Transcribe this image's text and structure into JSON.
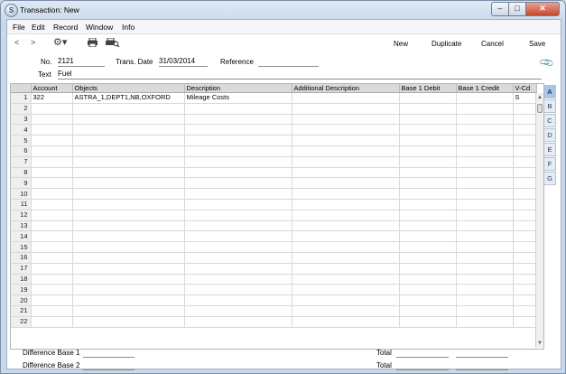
{
  "window": {
    "title": "Transaction: New",
    "app_icon_glyph": "S"
  },
  "menu": [
    "File",
    "Edit",
    "Record",
    "Window",
    "Info"
  ],
  "toolbar": {
    "nav_prev": "<",
    "nav_next": ">",
    "new_label": "New",
    "duplicate_label": "Duplicate",
    "cancel_label": "Cancel",
    "save_label": "Save",
    "icons": [
      "gear-icon",
      "print-icon",
      "print-preview-icon"
    ]
  },
  "form": {
    "no_label": "No.",
    "no_value": "2121",
    "trans_date_label": "Trans. Date",
    "trans_date_value": "31/03/2014",
    "reference_label": "Reference",
    "reference_value": "",
    "text_label": "Text",
    "text_value": "Fuel"
  },
  "grid": {
    "columns": [
      "",
      "Account",
      "Objects",
      "Description",
      "Additional Description",
      "Base 1 Debit",
      "Base 1 Credit",
      "V-Cd"
    ],
    "rows": [
      [
        "1",
        "322",
        "ASTRA_1,DEPT1,NB,OXFORD",
        "Mileage Costs",
        "",
        "",
        "",
        "S"
      ],
      [
        "2",
        "",
        "",
        "",
        "",
        "",
        "",
        ""
      ],
      [
        "3",
        "",
        "",
        "",
        "",
        "",
        "",
        ""
      ],
      [
        "4",
        "",
        "",
        "",
        "",
        "",
        "",
        ""
      ],
      [
        "5",
        "",
        "",
        "",
        "",
        "",
        "",
        ""
      ],
      [
        "6",
        "",
        "",
        "",
        "",
        "",
        "",
        ""
      ],
      [
        "7",
        "",
        "",
        "",
        "",
        "",
        "",
        ""
      ],
      [
        "8",
        "",
        "",
        "",
        "",
        "",
        "",
        ""
      ],
      [
        "9",
        "",
        "",
        "",
        "",
        "",
        "",
        ""
      ],
      [
        "10",
        "",
        "",
        "",
        "",
        "",
        "",
        ""
      ],
      [
        "11",
        "",
        "",
        "",
        "",
        "",
        "",
        ""
      ],
      [
        "12",
        "",
        "",
        "",
        "",
        "",
        "",
        ""
      ],
      [
        "13",
        "",
        "",
        "",
        "",
        "",
        "",
        ""
      ],
      [
        "14",
        "",
        "",
        "",
        "",
        "",
        "",
        ""
      ],
      [
        "15",
        "",
        "",
        "",
        "",
        "",
        "",
        ""
      ],
      [
        "16",
        "",
        "",
        "",
        "",
        "",
        "",
        ""
      ],
      [
        "17",
        "",
        "",
        "",
        "",
        "",
        "",
        ""
      ],
      [
        "18",
        "",
        "",
        "",
        "",
        "",
        "",
        ""
      ],
      [
        "19",
        "",
        "",
        "",
        "",
        "",
        "",
        ""
      ],
      [
        "20",
        "",
        "",
        "",
        "",
        "",
        "",
        ""
      ],
      [
        "21",
        "",
        "",
        "",
        "",
        "",
        "",
        ""
      ],
      [
        "22",
        "",
        "",
        "",
        "",
        "",
        "",
        ""
      ]
    ]
  },
  "side_tabs": [
    "A",
    "B",
    "C",
    "D",
    "E",
    "F",
    "G"
  ],
  "footer": {
    "diff1_label": "Difference Base 1",
    "diff2_label": "Difference Base 2",
    "total_label": "Total"
  }
}
